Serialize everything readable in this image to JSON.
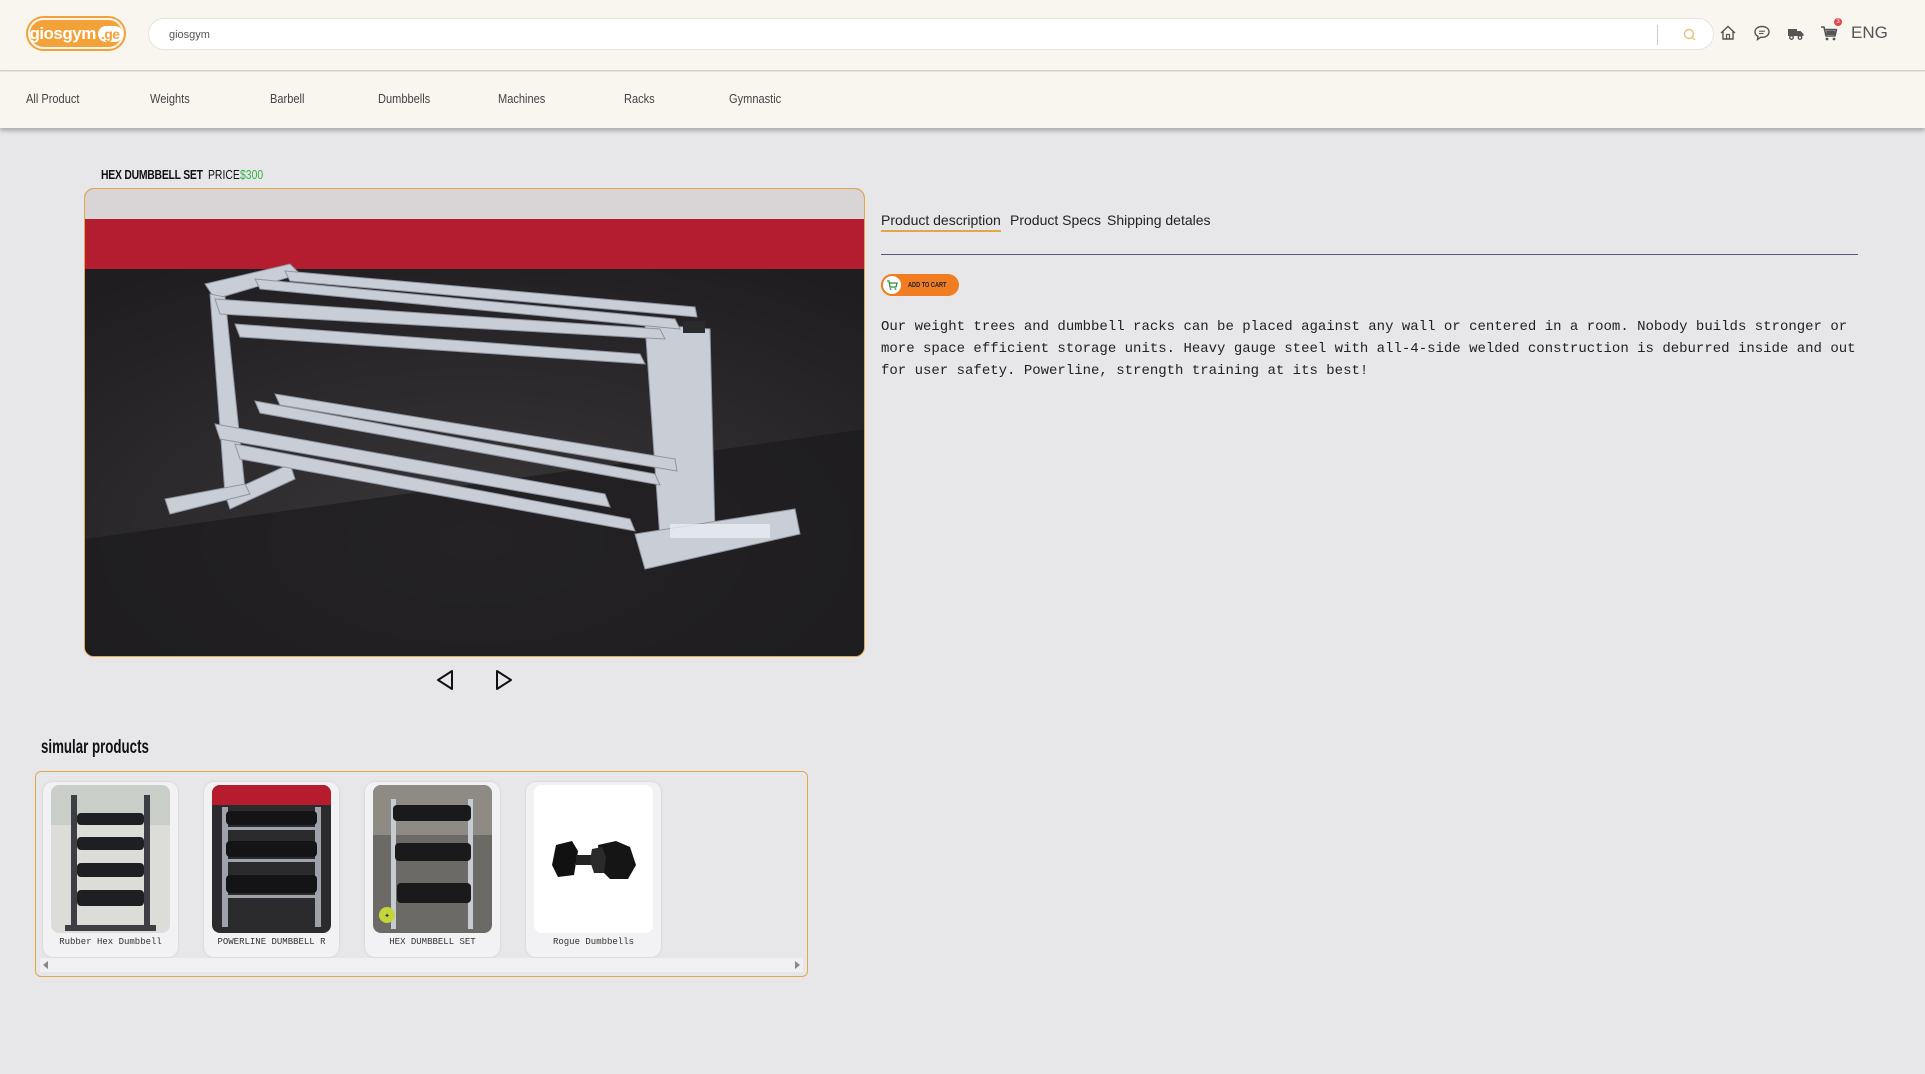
{
  "header": {
    "logo_main": "giosgym",
    "logo_tld": ".ge",
    "search_value": "giosgym",
    "cart_count": "3",
    "language": "ENG",
    "icons": [
      "search-icon",
      "home-icon",
      "chat-icon",
      "delivery-truck-icon",
      "cart-icon"
    ]
  },
  "nav": {
    "items": [
      "All Product",
      "Weights",
      "Barbell",
      "Dumbbells",
      "Machines",
      "Racks",
      "Gymnastic"
    ]
  },
  "product": {
    "title": "HEX DUMBBELL SET",
    "price_label": "PRICE",
    "price": "$300",
    "tabs": [
      "Product description",
      "Product Specs",
      "Shipping detales"
    ],
    "active_tab": 0,
    "add_to_cart": "ADD TO CART",
    "description": "Our weight trees and dumbbell racks can be placed against any wall or centered in a room. Nobody builds stronger or more space efficient storage units. Heavy gauge steel with all-4-side welded construction is deburred inside and out for user safety. Powerline, strength training at its best!"
  },
  "similar": {
    "title": "simular products",
    "items": [
      {
        "name": "Rubber Hex Dumbbell"
      },
      {
        "name": "POWERLINE DUMBBELL R"
      },
      {
        "name": "HEX DUMBBELL SET"
      },
      {
        "name": "Rogue Dumbbells"
      }
    ]
  },
  "colors": {
    "accent": "#e3a64b",
    "price": "#34b34a",
    "cart_button": "#f07d21",
    "header_bg": "#f8f6ee",
    "page_bg": "#e7e7ea"
  }
}
